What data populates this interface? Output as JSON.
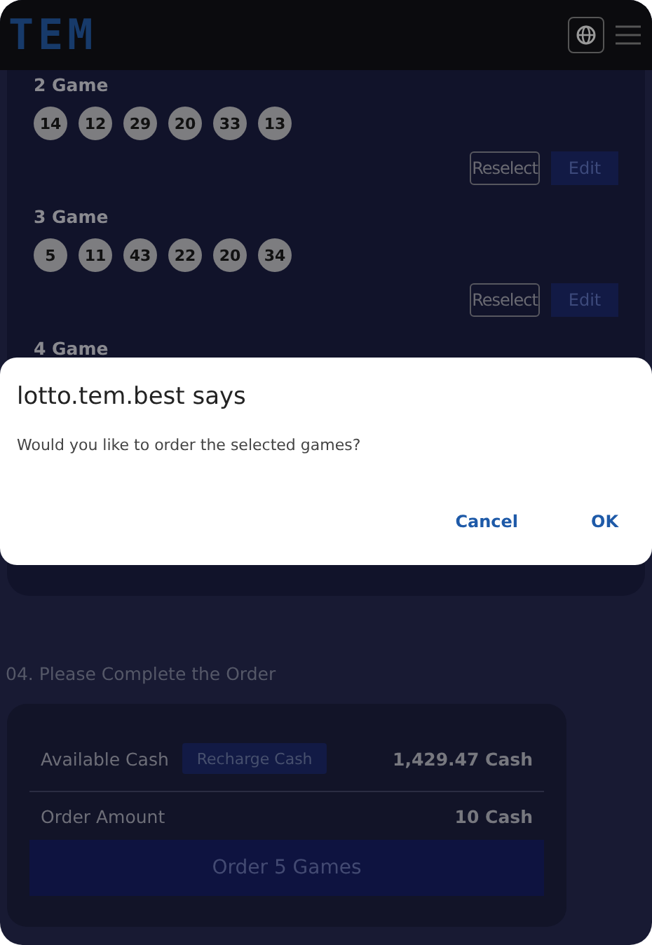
{
  "header": {
    "logo": "TEM"
  },
  "games": [
    {
      "title": "2 Game",
      "numbers": [
        "14",
        "12",
        "29",
        "20",
        "33",
        "13"
      ],
      "buttons": [
        "Reselect",
        "Edit"
      ]
    },
    {
      "title": "3 Game",
      "numbers": [
        "5",
        "11",
        "43",
        "22",
        "20",
        "34"
      ],
      "buttons": [
        "Reselect",
        "Edit"
      ]
    },
    {
      "title": "4 Game"
    }
  ],
  "order": {
    "heading": "04. Please Complete the Order",
    "available_label": "Available Cash",
    "recharge_button": "Recharge Cash",
    "available_value": "1,429.47 Cash",
    "amount_label": "Order Amount",
    "amount_value": "10 Cash",
    "order_button": "Order 5 Games"
  },
  "dialog": {
    "title": "lotto.tem.best says",
    "message": "Would you like to order the selected games?",
    "buttons": [
      "Cancel",
      "OK"
    ]
  }
}
